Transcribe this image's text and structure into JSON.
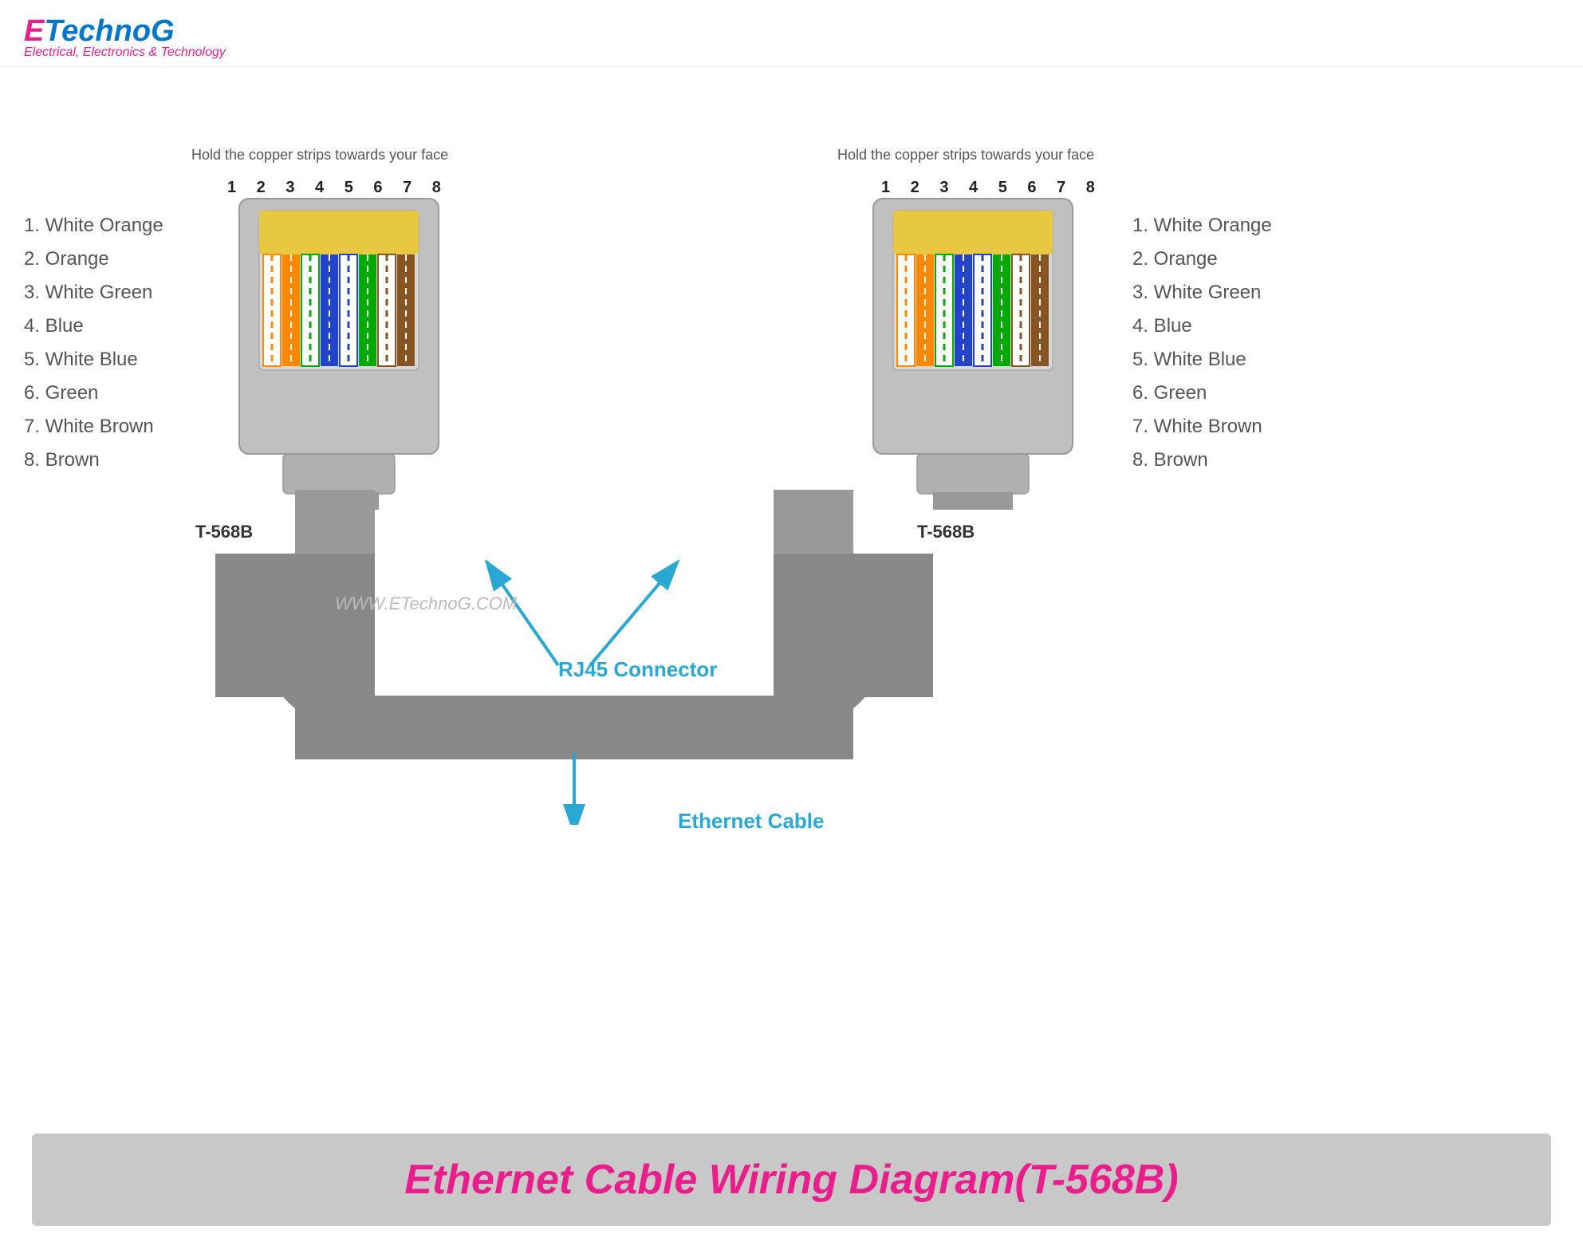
{
  "logo": {
    "e": "E",
    "technog": "TechnoG",
    "tagline": "Electrical, Electronics & Technology"
  },
  "instruction": "Hold the copper strips towards your face",
  "pin_numbers": "1 2 3 4 5 6 7 8",
  "wire_labels": [
    "1. White Orange",
    "2. Orange",
    "3. White Green",
    "4. Blue",
    "5. White Blue",
    "6. Green",
    "7. White Brown",
    "8. Brown"
  ],
  "standard_label": "T-568B",
  "rj45_label": "RJ45 Connector",
  "ethernet_label": "Ethernet Cable",
  "watermark": "WWW.ETechnoG.COM",
  "footer_title": "Ethernet Cable Wiring Diagram(T-568B)"
}
